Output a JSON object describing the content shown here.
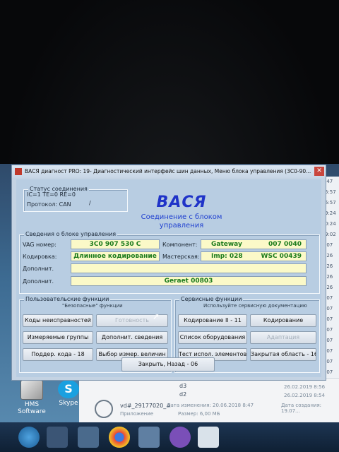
{
  "window": {
    "title": "ВАСЯ диагност PRO: 19- Диагностический интерфейс шин данных,  Меню блока управления (3C0-90...",
    "close_label": "✕"
  },
  "logo": {
    "text": "ВАСЯ",
    "subtitle": "Соединение с блоком управления"
  },
  "status": {
    "legend": "Статус соединения",
    "line1": "IC=1  TE=0  RE=0",
    "line2": "Протокол: CAN",
    "indicator": "/"
  },
  "unit_info": {
    "legend": "Сведения о блоке управления",
    "vag_label": "VAG номер:",
    "vag_value": "3C0 907 530 C",
    "component_label": "Компонент:",
    "component_name": "Gateway",
    "component_code": "007 0040",
    "coding_label": "Кодировка:",
    "coding_value": "Длинное кодирование",
    "workshop_label": "Мастерская:",
    "imp_value": "Imp: 028",
    "wsc_value": "WSC 00439",
    "extra1_label": "Дополнит.",
    "extra1_value": "",
    "extra2_label": "Дополнит.",
    "extra2_value": "Geraet 00803"
  },
  "basic_functions": {
    "legend": "Пользовательские функции",
    "sub": "\"Безопасные\" функции",
    "buttons": [
      {
        "label": "Коды неисправностей",
        "enabled": true
      },
      {
        "label": "Готовность",
        "enabled": false
      },
      {
        "label": "Измеряемые группы",
        "enabled": true
      },
      {
        "label": "Дополнит. сведения",
        "enabled": true
      },
      {
        "label": "Поддер. кода - 18",
        "enabled": true
      },
      {
        "label": "Выбор измер. величин",
        "enabled": true
      }
    ]
  },
  "service_functions": {
    "legend": "Сервисные функции",
    "sub": "Используйте сервисную документацию",
    "buttons": [
      {
        "label": "Кодирование II - 11",
        "enabled": true
      },
      {
        "label": "Кодирование",
        "enabled": true
      },
      {
        "label": "Список оборудования",
        "enabled": true
      },
      {
        "label": "Адаптация",
        "enabled": false
      },
      {
        "label": "Тест испол. элементов",
        "enabled": true
      },
      {
        "label": "Закрытая область - 16",
        "enabled": true
      }
    ]
  },
  "close_back_label": "Закрыть, Назад - 06",
  "desktop": {
    "icons": [
      {
        "label": "HMS Software"
      },
      {
        "label": "Skype"
      }
    ],
    "skype_glyph": "S",
    "explorer": {
      "item1": "d3",
      "item1_date": "26.02.2019 8:56",
      "item2": "d2",
      "item2_date": "26.02.2019 8:54",
      "file_name": "vd#_29177020_#",
      "file_kind": "Приложение",
      "modified_label": "Дата изменения: 20.06.2018 8:47",
      "size_label": "Размер: 6,00 МБ",
      "created_label": "Дата создания: 19.07..."
    },
    "right_strip": [
      ":47",
      "5:57",
      "5:57",
      "9:24",
      "0:24",
      "9:02",
      ":07",
      ":26",
      ":26",
      ":26",
      ":26",
      ":07",
      ":07",
      ":07",
      ":07",
      ":07",
      ":07",
      ":07",
      ":07",
      ":07"
    ]
  }
}
